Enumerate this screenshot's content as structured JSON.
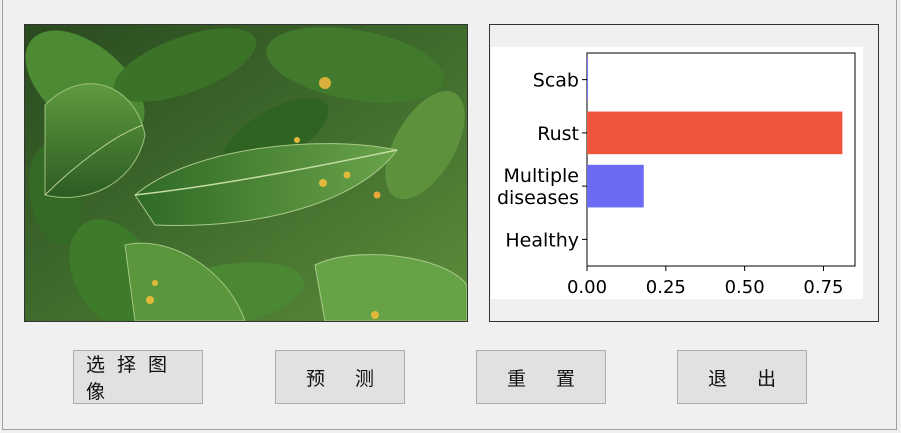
{
  "buttons": {
    "select_image": "选择图像",
    "predict": "预 测",
    "reset": "重 置",
    "exit": "退 出"
  },
  "image": {
    "subject": "apple leaf with rust spots",
    "colors": {
      "leaf": "#3f7a2a",
      "leaf_light": "#6ea447",
      "spot": "#e2b83a",
      "background": "#1f3d16"
    }
  },
  "chart_data": {
    "type": "bar",
    "orientation": "horizontal",
    "categories": [
      "Scab",
      "Rust",
      "Multiple\ndiseases",
      "Healthy"
    ],
    "values": [
      0.003,
      0.81,
      0.18,
      0.0
    ],
    "colors": [
      "#6b6bf5",
      "#ef553b",
      "#6b6bf5",
      "#6b6bf5"
    ],
    "xlim": [
      0,
      0.85
    ],
    "xticks": [
      "0.00",
      "0.25",
      "0.50",
      "0.75"
    ],
    "xtick_values": [
      0,
      0.25,
      0.5,
      0.75
    ],
    "title": "",
    "xlabel": "",
    "ylabel": "",
    "grid": false
  }
}
